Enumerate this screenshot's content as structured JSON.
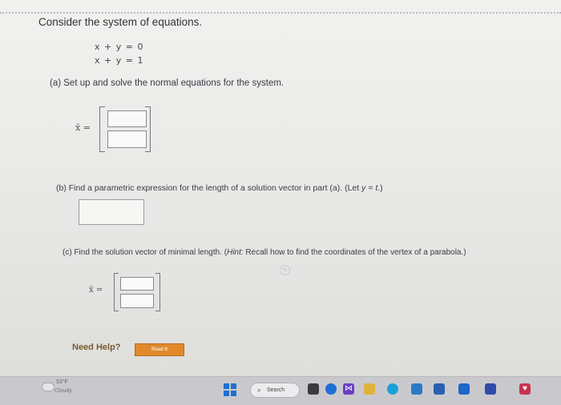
{
  "question": {
    "intro": "Consider the system of equations.",
    "equations": [
      "x + y = 0",
      "x + y = 1"
    ],
    "part_a": {
      "text": "(a) Set up and solve the normal equations for the system.",
      "vector_label": "x̄ ="
    },
    "part_b": {
      "text_before": "(b) Find a parametric expression for the length of a solution vector in part (a). (Let ",
      "let_expr": "y = t.",
      "text_after": ")"
    },
    "part_c": {
      "text_before": "(c) Find the solution vector of minimal length. (",
      "hint_label": "Hint:",
      "hint_text": " Recall how to find the coordinates of the vertex of a parabola.)",
      "vector_label": "x̄ ="
    },
    "need_help": "Need Help?",
    "read_button": "Read It"
  },
  "taskbar": {
    "weather_temp": "53°F",
    "weather_condition": "Cloudy",
    "search_label": "Search",
    "icons": [
      "file-explorer-icon",
      "onedrive-icon",
      "visual-studio-icon",
      "folder-icon",
      "edge-icon",
      "app-icon",
      "word-icon",
      "app-blue-icon",
      "mail-icon",
      "photos-icon"
    ]
  }
}
